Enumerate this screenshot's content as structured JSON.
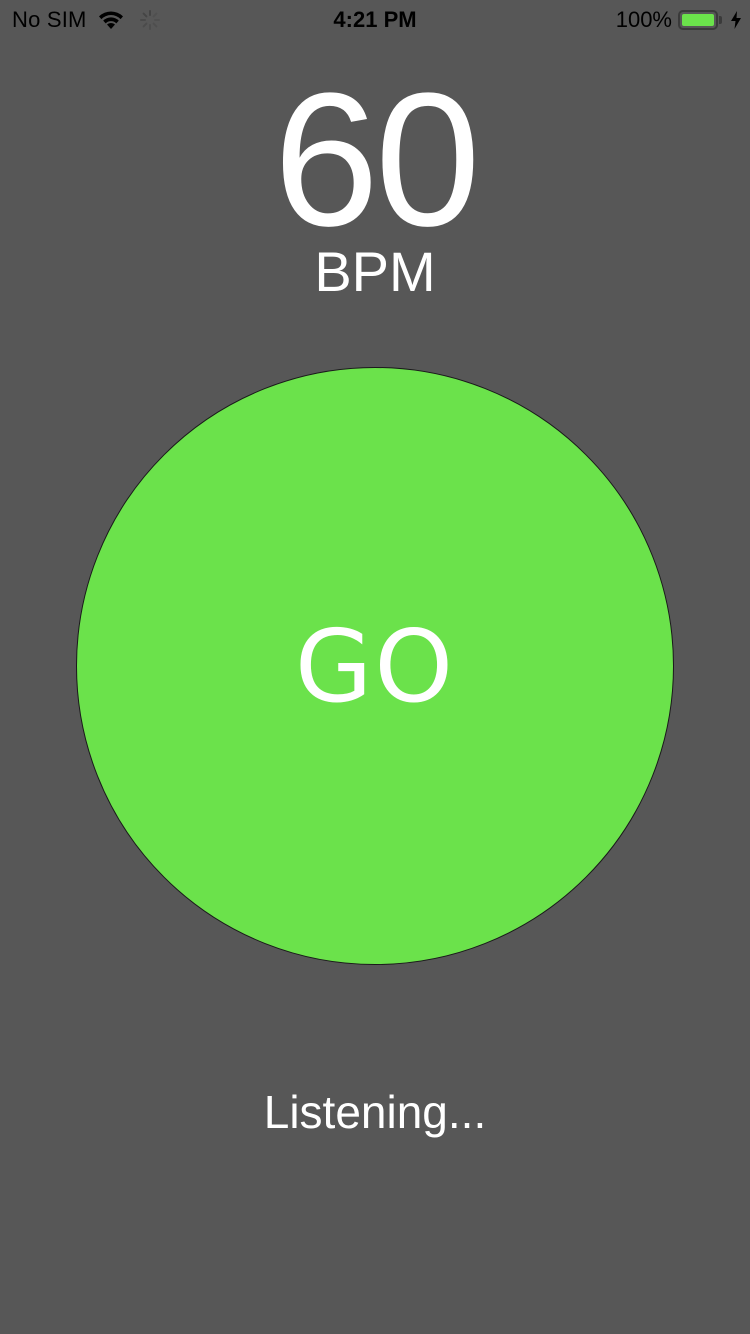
{
  "status_bar": {
    "carrier": "No SIM",
    "time": "4:21 PM",
    "battery_percent": "100%",
    "battery_level": 1.0,
    "icons": [
      "wifi-icon",
      "activity-spinner-icon",
      "battery-icon",
      "charging-bolt-icon"
    ]
  },
  "tempo": {
    "value": "60",
    "unit": "BPM"
  },
  "go_button": {
    "label": "GO",
    "color": "#6be24b"
  },
  "status_message": "Listening...",
  "colors": {
    "background": "#575757",
    "accent": "#6be24b",
    "text": "#ffffff"
  }
}
